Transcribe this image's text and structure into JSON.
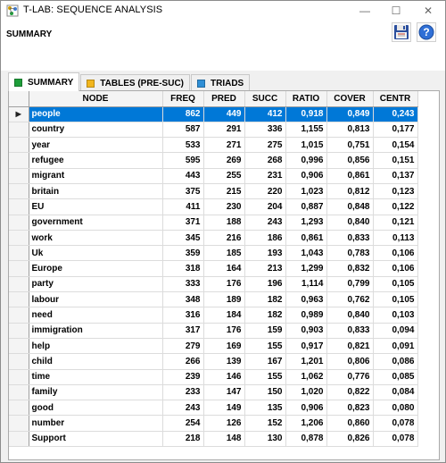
{
  "window": {
    "title": "T-LAB: SEQUENCE ANALYSIS",
    "minimize_glyph": "—",
    "maximize_glyph": "☐",
    "close_glyph": "✕"
  },
  "header": {
    "heading": "SUMMARY",
    "save_icon": "floppy-disk-icon",
    "help_icon": "question-mark-icon",
    "help_glyph": "?"
  },
  "tabs": [
    {
      "label": "SUMMARY",
      "color": "#1e9e3a",
      "active": true
    },
    {
      "label": "TABLES (PRE-SUC)",
      "color": "#f2b61e",
      "active": false
    },
    {
      "label": "TRIADS",
      "color": "#2f8fd6",
      "active": false
    }
  ],
  "grid": {
    "columns": [
      "NODE",
      "FREQ",
      "PRED",
      "SUCC",
      "RATIO",
      "COVER",
      "CENTR"
    ],
    "current_row_marker": "▶",
    "selection_color": "#0078d7",
    "rows": [
      [
        "people",
        "862",
        "449",
        "412",
        "0,918",
        "0,849",
        "0,243"
      ],
      [
        "country",
        "587",
        "291",
        "336",
        "1,155",
        "0,813",
        "0,177"
      ],
      [
        "year",
        "533",
        "271",
        "275",
        "1,015",
        "0,751",
        "0,154"
      ],
      [
        "refugee",
        "595",
        "269",
        "268",
        "0,996",
        "0,856",
        "0,151"
      ],
      [
        "migrant",
        "443",
        "255",
        "231",
        "0,906",
        "0,861",
        "0,137"
      ],
      [
        "britain",
        "375",
        "215",
        "220",
        "1,023",
        "0,812",
        "0,123"
      ],
      [
        "EU",
        "411",
        "230",
        "204",
        "0,887",
        "0,848",
        "0,122"
      ],
      [
        "government",
        "371",
        "188",
        "243",
        "1,293",
        "0,840",
        "0,121"
      ],
      [
        "work",
        "345",
        "216",
        "186",
        "0,861",
        "0,833",
        "0,113"
      ],
      [
        "Uk",
        "359",
        "185",
        "193",
        "1,043",
        "0,783",
        "0,106"
      ],
      [
        "Europe",
        "318",
        "164",
        "213",
        "1,299",
        "0,832",
        "0,106"
      ],
      [
        "party",
        "333",
        "176",
        "196",
        "1,114",
        "0,799",
        "0,105"
      ],
      [
        "labour",
        "348",
        "189",
        "182",
        "0,963",
        "0,762",
        "0,105"
      ],
      [
        "need",
        "316",
        "184",
        "182",
        "0,989",
        "0,840",
        "0,103"
      ],
      [
        "immigration",
        "317",
        "176",
        "159",
        "0,903",
        "0,833",
        "0,094"
      ],
      [
        "help",
        "279",
        "169",
        "155",
        "0,917",
        "0,821",
        "0,091"
      ],
      [
        "child",
        "266",
        "139",
        "167",
        "1,201",
        "0,806",
        "0,086"
      ],
      [
        "time",
        "239",
        "146",
        "155",
        "1,062",
        "0,776",
        "0,085"
      ],
      [
        "family",
        "233",
        "147",
        "150",
        "1,020",
        "0,822",
        "0,084"
      ],
      [
        "good",
        "243",
        "149",
        "135",
        "0,906",
        "0,823",
        "0,080"
      ],
      [
        "number",
        "254",
        "126",
        "152",
        "1,206",
        "0,860",
        "0,078"
      ],
      [
        "Support",
        "218",
        "148",
        "130",
        "0,878",
        "0,826",
        "0,078"
      ]
    ]
  }
}
